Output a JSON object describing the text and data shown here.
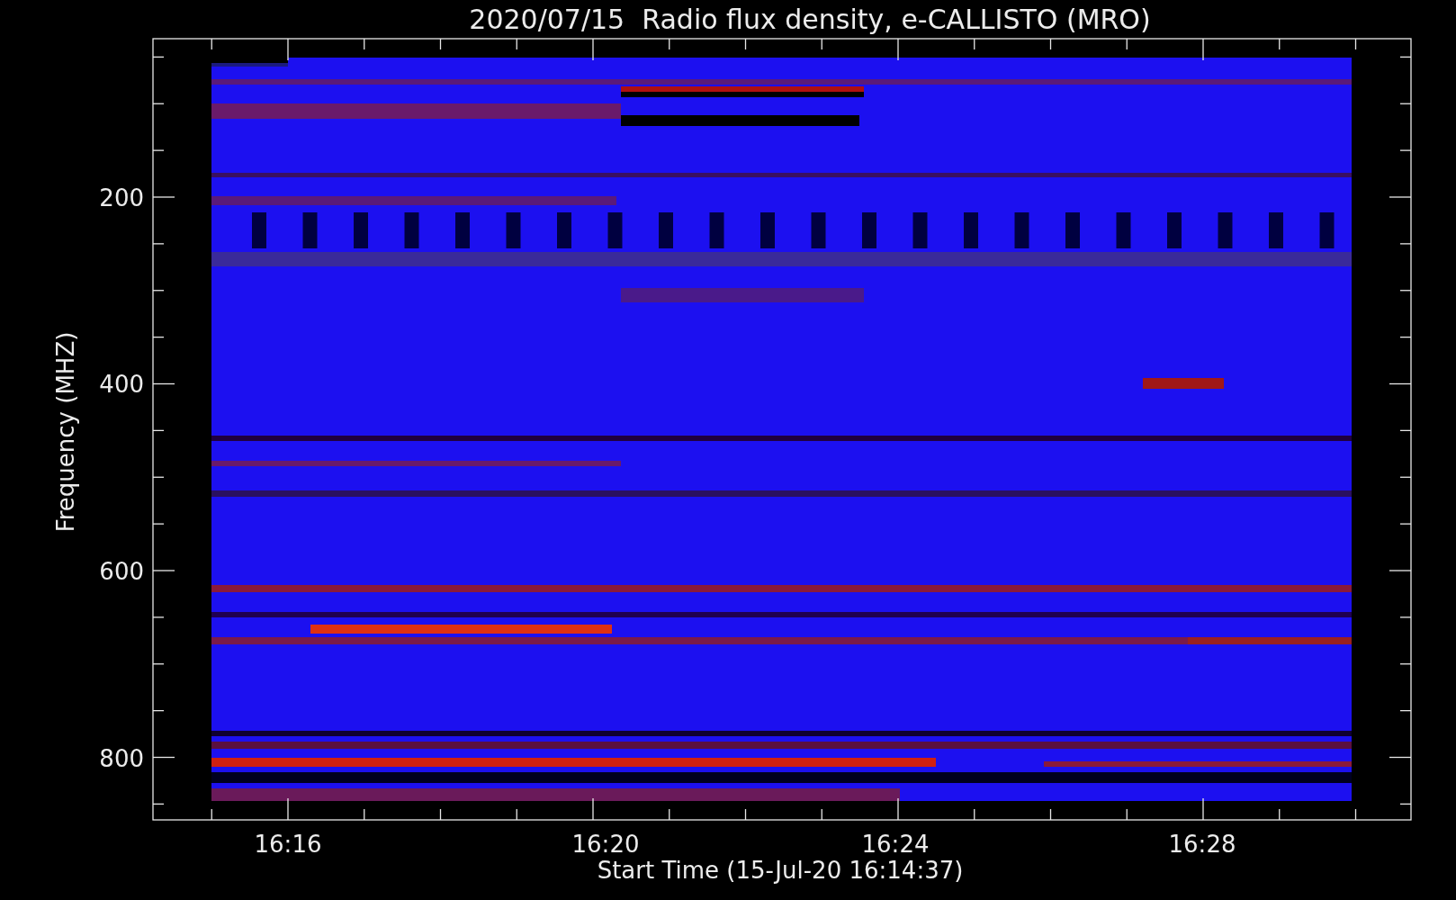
{
  "title": "2020/07/15  Radio flux density, e-CALLISTO (MRO)",
  "y_axis": {
    "label": "Frequency (MHZ)",
    "ticks": [
      "200",
      "400",
      "600",
      "800"
    ]
  },
  "x_axis": {
    "label": "Start Time (15-Jul-20 16:14:37)",
    "ticks": [
      "16:16",
      "16:20",
      "16:24",
      "16:28"
    ]
  }
}
